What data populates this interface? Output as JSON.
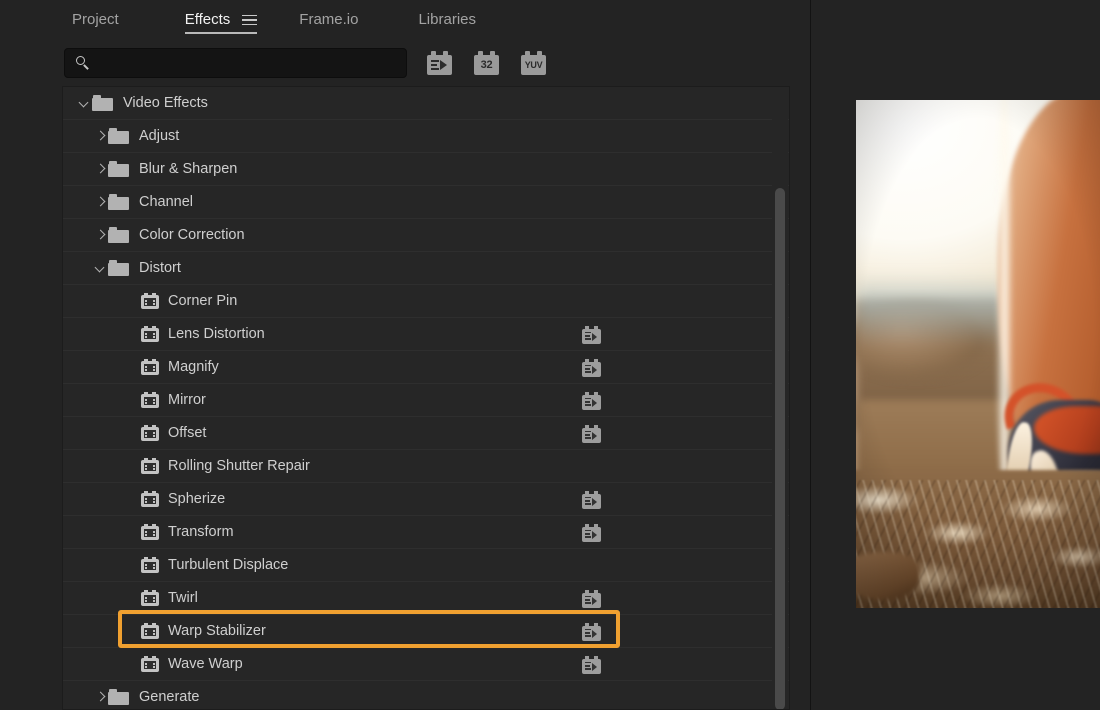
{
  "tabs": [
    {
      "label": "Project",
      "name": "tab-project",
      "active": false,
      "has_menu": false
    },
    {
      "label": "Effects",
      "name": "tab-effects",
      "active": true,
      "has_menu": true
    },
    {
      "label": "Frame.io",
      "name": "tab-frameio",
      "active": false,
      "has_menu": false
    },
    {
      "label": "Libraries",
      "name": "tab-libraries",
      "active": false,
      "has_menu": false
    }
  ],
  "search": {
    "value": "",
    "placeholder": "",
    "icon": "search-icon"
  },
  "filters": [
    {
      "name": "accelerated-effects-filter",
      "icon": "accelerated-effects-icon",
      "label": ""
    },
    {
      "name": "32-bit-color-filter",
      "icon": "32-bit-icon",
      "label": "32"
    },
    {
      "name": "yuv-color-filter",
      "icon": "yuv-icon",
      "label": "YUV"
    }
  ],
  "tree": {
    "rows": [
      {
        "label": "Video Effects",
        "level": 0,
        "type": "folder",
        "expanded": true,
        "accelerated": false
      },
      {
        "label": "Adjust",
        "level": 1,
        "type": "folder",
        "expanded": false,
        "accelerated": false
      },
      {
        "label": "Blur & Sharpen",
        "level": 1,
        "type": "folder",
        "expanded": false,
        "accelerated": false
      },
      {
        "label": "Channel",
        "level": 1,
        "type": "folder",
        "expanded": false,
        "accelerated": false
      },
      {
        "label": "Color Correction",
        "level": 1,
        "type": "folder",
        "expanded": false,
        "accelerated": false
      },
      {
        "label": "Distort",
        "level": 1,
        "type": "folder",
        "expanded": true,
        "accelerated": false
      },
      {
        "label": "Corner Pin",
        "level": 2,
        "type": "effect",
        "accelerated": false
      },
      {
        "label": "Lens Distortion",
        "level": 2,
        "type": "effect",
        "accelerated": true
      },
      {
        "label": "Magnify",
        "level": 2,
        "type": "effect",
        "accelerated": true
      },
      {
        "label": "Mirror",
        "level": 2,
        "type": "effect",
        "accelerated": true
      },
      {
        "label": "Offset",
        "level": 2,
        "type": "effect",
        "accelerated": true
      },
      {
        "label": "Rolling Shutter Repair",
        "level": 2,
        "type": "effect",
        "accelerated": false
      },
      {
        "label": "Spherize",
        "level": 2,
        "type": "effect",
        "accelerated": true
      },
      {
        "label": "Transform",
        "level": 2,
        "type": "effect",
        "accelerated": true
      },
      {
        "label": "Turbulent Displace",
        "level": 2,
        "type": "effect",
        "accelerated": false
      },
      {
        "label": "Twirl",
        "level": 2,
        "type": "effect",
        "accelerated": true
      },
      {
        "label": "Warp Stabilizer",
        "level": 2,
        "type": "effect",
        "accelerated": true,
        "highlighted": true
      },
      {
        "label": "Wave Warp",
        "level": 2,
        "type": "effect",
        "accelerated": true
      },
      {
        "label": "Generate",
        "level": 1,
        "type": "folder",
        "expanded": false,
        "accelerated": false
      }
    ]
  },
  "highlight": {
    "target": "Warp Stabilizer",
    "color": "#f0a030"
  },
  "monitor": {
    "name": "program-monitor-preview",
    "description": "blurred photo of a runner's leg and orange running shoe on gravel ground"
  },
  "colors": {
    "app_background": "#232323",
    "panel_background": "#262626",
    "row_separator": "#2e2e2e",
    "text_primary": "#cfcfcf",
    "text_active": "#f2f2f2",
    "text_muted": "#a3a3a3",
    "highlight_orange": "#f0a030",
    "search_field": "#141414",
    "scrollbar_thumb": "#4a4a4a"
  }
}
